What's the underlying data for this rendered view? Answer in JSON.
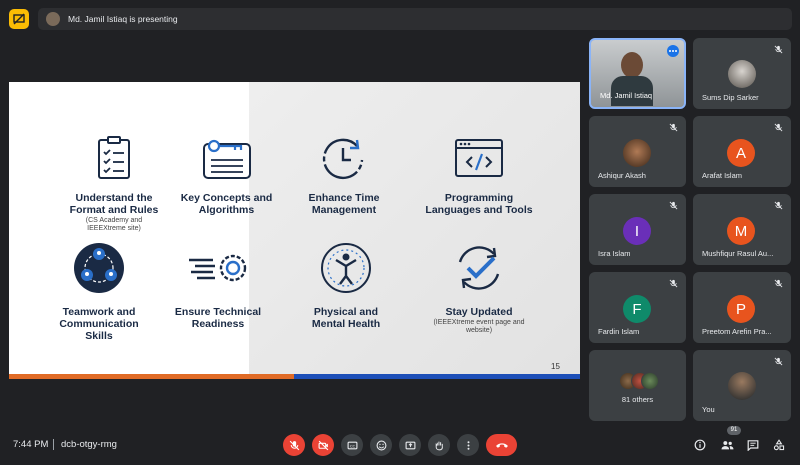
{
  "topbar": {
    "presenting_text": "Md. Jamil Istiaq is presenting"
  },
  "slide": {
    "page_number": "15",
    "items": [
      {
        "title": "Understand the\nFormat and Rules",
        "subtitle": "(CS Academy and\nIEEEXtreme site)",
        "icon": "clipboard-checklist-icon"
      },
      {
        "title": "Key Concepts and\nAlgorithms",
        "subtitle": "",
        "icon": "key-card-icon"
      },
      {
        "title": "Enhance Time\nManagement",
        "subtitle": "",
        "icon": "clock-icon"
      },
      {
        "title": "Programming\nLanguages and Tools",
        "subtitle": "",
        "icon": "code-window-icon"
      },
      {
        "title": "Teamwork and\nCommunication\nSkills",
        "subtitle": "",
        "icon": "team-circle-icon"
      },
      {
        "title": "Ensure Technical\nReadiness",
        "subtitle": "",
        "icon": "fast-gear-icon"
      },
      {
        "title": "Physical and\nMental Health",
        "subtitle": "",
        "icon": "wellbeing-person-icon"
      },
      {
        "title": "Stay Updated",
        "subtitle": "(IEEEXtreme event page and\nwebsite)",
        "icon": "refresh-check-icon"
      }
    ]
  },
  "participants": [
    {
      "name": "Md. Jamil Istiaq",
      "initial": "",
      "color": "",
      "kind": "video",
      "active": true
    },
    {
      "name": "Sums Dip Sarker",
      "initial": "",
      "color": "",
      "kind": "photo"
    },
    {
      "name": "Ashiqur Akash",
      "initial": "",
      "color": "",
      "kind": "photo"
    },
    {
      "name": "Arafat Islam",
      "initial": "A",
      "color": "#e8541e"
    },
    {
      "name": "Isra Islam",
      "initial": "I",
      "color": "#6a2fb8"
    },
    {
      "name": "Mushfiqur Rasul Au...",
      "initial": "M",
      "color": "#e8541e"
    },
    {
      "name": "Fardin Islam",
      "initial": "F",
      "color": "#0f8a6a"
    },
    {
      "name": "Preetom Arefin Pra...",
      "initial": "P",
      "color": "#e8541e"
    },
    {
      "name": "81 others",
      "initial": "",
      "color": "",
      "kind": "group"
    },
    {
      "name": "You",
      "initial": "",
      "color": "",
      "kind": "photo"
    }
  ],
  "bottombar": {
    "time": "7:44 PM",
    "meeting_code": "dcb-otgy-rmg",
    "people_count": "91"
  },
  "colors": {
    "accent_red": "#ea4335",
    "present_yellow": "#fbbc04",
    "slide_orange": "#e06b26",
    "slide_blue": "#1d4fb8"
  }
}
